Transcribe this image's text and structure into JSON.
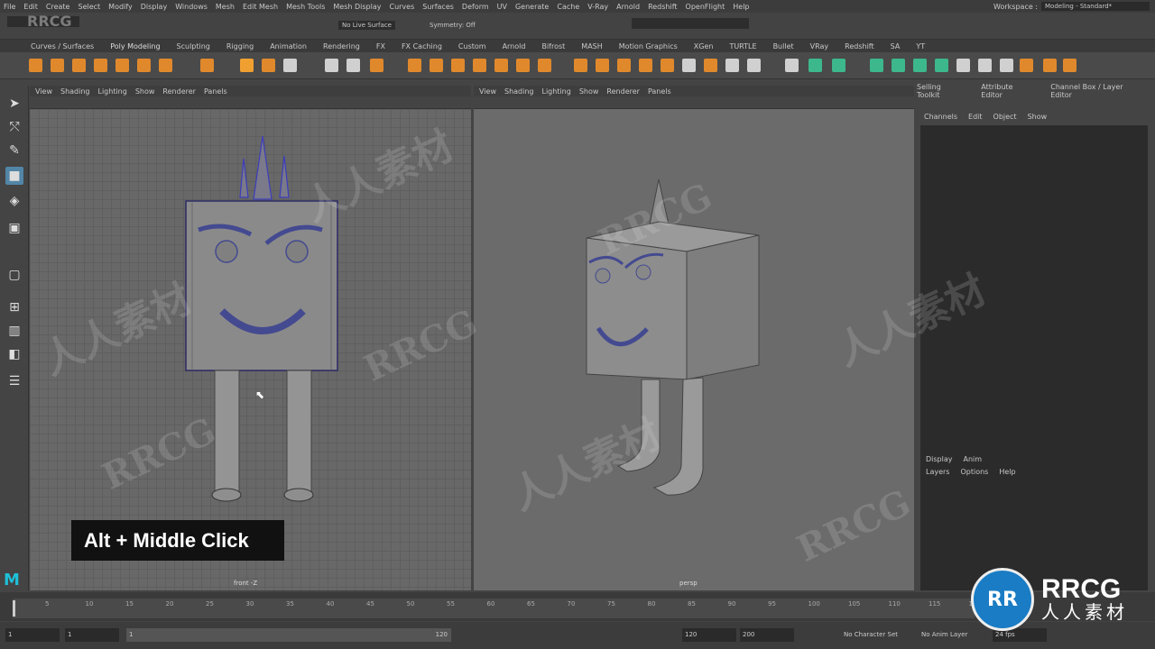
{
  "watermark_top": "RRCG",
  "menubar": [
    "File",
    "Edit",
    "Create",
    "Select",
    "Modify",
    "Display",
    "Windows",
    "Mesh",
    "Edit Mesh",
    "Mesh Tools",
    "Mesh Display",
    "Curves",
    "Surfaces",
    "Deform",
    "UV",
    "Generate",
    "Cache",
    "V-Ray",
    "Arnold",
    "Redshift",
    "OpenFlight",
    "Help"
  ],
  "workspace": {
    "label": "Workspace :",
    "value": "Modeling - Standard*"
  },
  "statusline": {
    "live_surface": "No Live Surface",
    "symmetry": "Symmetry: Off"
  },
  "shelf_tabs": [
    "Curves / Surfaces",
    "Poly Modeling",
    "Sculpting",
    "Rigging",
    "Animation",
    "Rendering",
    "FX",
    "FX Caching",
    "Custom",
    "Arnold",
    "Bifrost",
    "MASH",
    "Motion Graphics",
    "XGen",
    "TURTLE",
    "Bullet",
    "VRay",
    "Redshift",
    "SA",
    "YT"
  ],
  "viewport_menu": [
    "View",
    "Shading",
    "Lighting",
    "Show",
    "Renderer",
    "Panels"
  ],
  "viewport_left": {
    "camera": "front -Z"
  },
  "viewport_right": {
    "camera": "persp"
  },
  "hint_text": "Alt + Middle Click",
  "right_panel": {
    "tabs": [
      "Selling Toolkit",
      "Attribute Editor",
      "Channel Box / Layer Editor"
    ],
    "channel_menu": [
      "Channels",
      "Edit",
      "Object",
      "Show"
    ],
    "layer_tabs": [
      "Display",
      "Anim"
    ],
    "layer_menu": [
      "Layers",
      "Options",
      "Help"
    ]
  },
  "timeline": {
    "ticks": [
      "5",
      "10",
      "15",
      "20",
      "25",
      "30",
      "35",
      "40",
      "45",
      "50",
      "55",
      "60",
      "65",
      "70",
      "75",
      "80",
      "85",
      "90",
      "95",
      "100",
      "105",
      "110",
      "115",
      "120"
    ],
    "current": "1"
  },
  "range": {
    "start": "1",
    "start_inner": "1",
    "slider_start": "1",
    "slider_end": "120",
    "end_inner": "120",
    "end": "200",
    "character_set": "No Character Set",
    "anim_layer": "No Anim Layer",
    "fps": "24 fps"
  },
  "watermarks": {
    "latin": "RRCG",
    "cjk": "人人素材"
  },
  "badge": {
    "title": "RRCG",
    "subtitle": "人人素材",
    "logo_letters": "RR"
  },
  "maya_logo": "M"
}
